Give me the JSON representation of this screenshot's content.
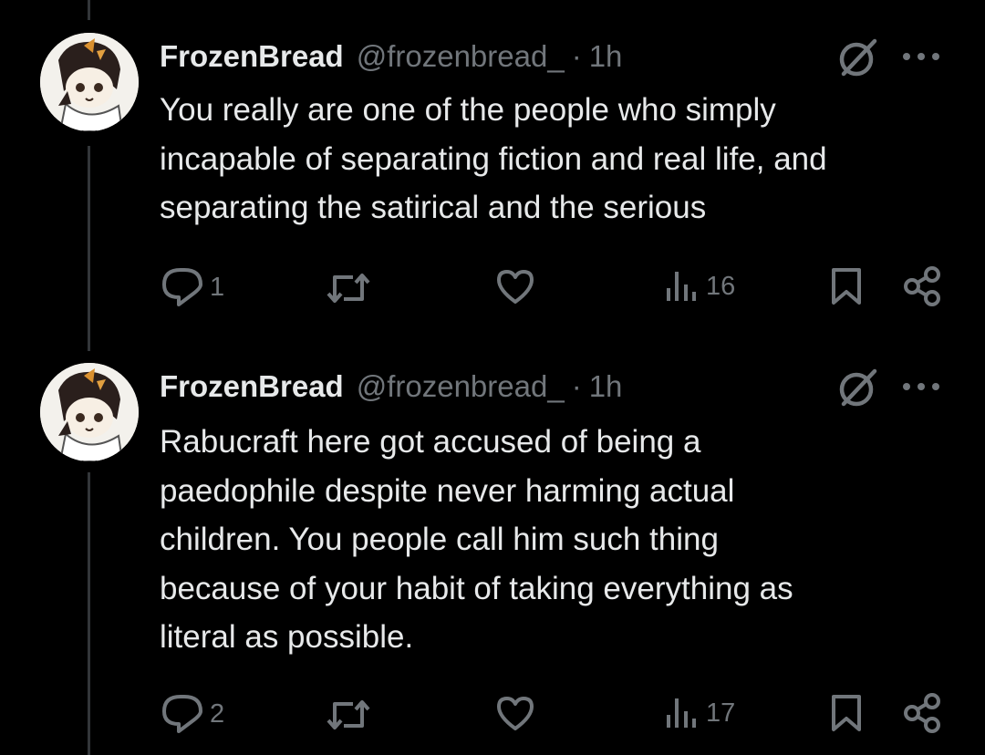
{
  "tweets": [
    {
      "author_name": "FrozenBread",
      "handle": "@frozenbread_",
      "separator": "·",
      "time": "1h",
      "lines": [
        "You really are one of the people who simply",
        "incapable of separating fiction and real life, and",
        "separating the satirical and the serious"
      ],
      "replies": "1",
      "views": "16"
    },
    {
      "author_name": "FrozenBread",
      "handle": "@frozenbread_",
      "separator": "·",
      "time": "1h",
      "lines": [
        "Rabucraft here got accused of being a",
        "paedophile despite never harming actual",
        "children. You people call him such thing",
        "because of your habit of taking everything as",
        "literal as possible."
      ],
      "replies": "2",
      "views": "17"
    }
  ],
  "icons": {
    "reply": "reply-icon",
    "retweet": "retweet-icon",
    "like": "heart-icon",
    "views": "views-icon",
    "bookmark": "bookmark-icon",
    "share": "share-icon",
    "grok": "grok-icon",
    "more": "more-icon"
  },
  "colors": {
    "background": "#000000",
    "text": "#e7e9ea",
    "muted": "#71767b",
    "thread_line": "#333639"
  }
}
